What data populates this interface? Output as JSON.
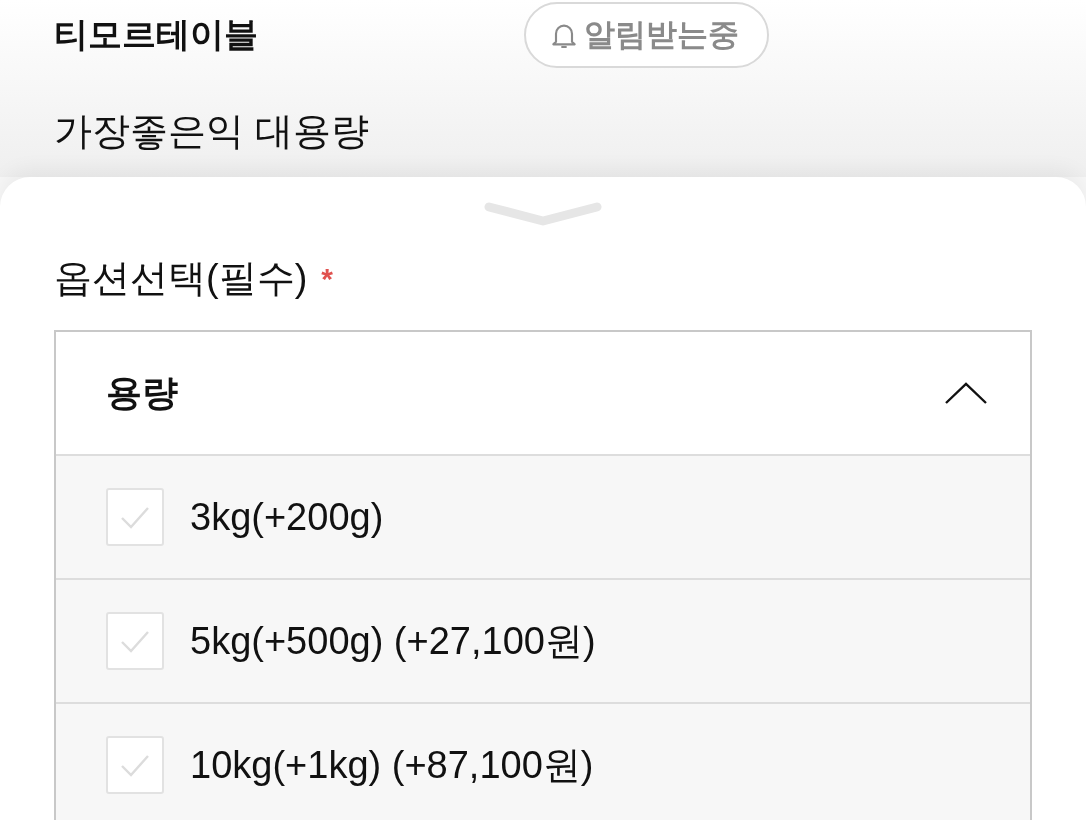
{
  "header": {
    "brand": "티모르테이블",
    "alert_button": {
      "label": "알림받는중",
      "on": true
    }
  },
  "product": {
    "title": "가장좋은익 대용량"
  },
  "sheet": {
    "section_label": "옵션선택(필수)",
    "required_mark": "*",
    "dropdown": {
      "label": "용량",
      "expanded": true,
      "options": [
        {
          "label": "3kg(+200g)",
          "checked": false
        },
        {
          "label": "5kg(+500g) (+27,100원)",
          "checked": false
        },
        {
          "label": "10kg(+1kg) (+87,100원)",
          "checked": false
        }
      ]
    }
  }
}
